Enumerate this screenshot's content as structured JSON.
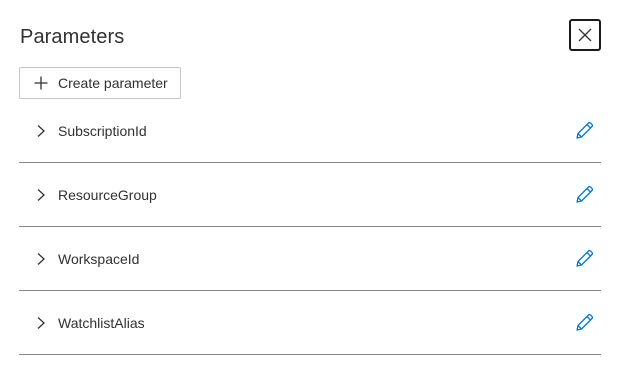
{
  "panel": {
    "title": "Parameters",
    "close_icon": "close-icon"
  },
  "toolbar": {
    "create_label": "Create parameter",
    "create_icon": "plus-icon"
  },
  "parameters": [
    {
      "name": "SubscriptionId",
      "expand_icon": "chevron-right-icon",
      "edit_icon": "pencil-icon"
    },
    {
      "name": "ResourceGroup",
      "expand_icon": "chevron-right-icon",
      "edit_icon": "pencil-icon"
    },
    {
      "name": "WorkspaceId",
      "expand_icon": "chevron-right-icon",
      "edit_icon": "pencil-icon"
    },
    {
      "name": "WatchlistAlias",
      "expand_icon": "chevron-right-icon",
      "edit_icon": "pencil-icon"
    }
  ],
  "colors": {
    "text": "#323130",
    "accent": "#0078d4",
    "divider": "#8a8886",
    "button_border": "#c8c6c4"
  }
}
